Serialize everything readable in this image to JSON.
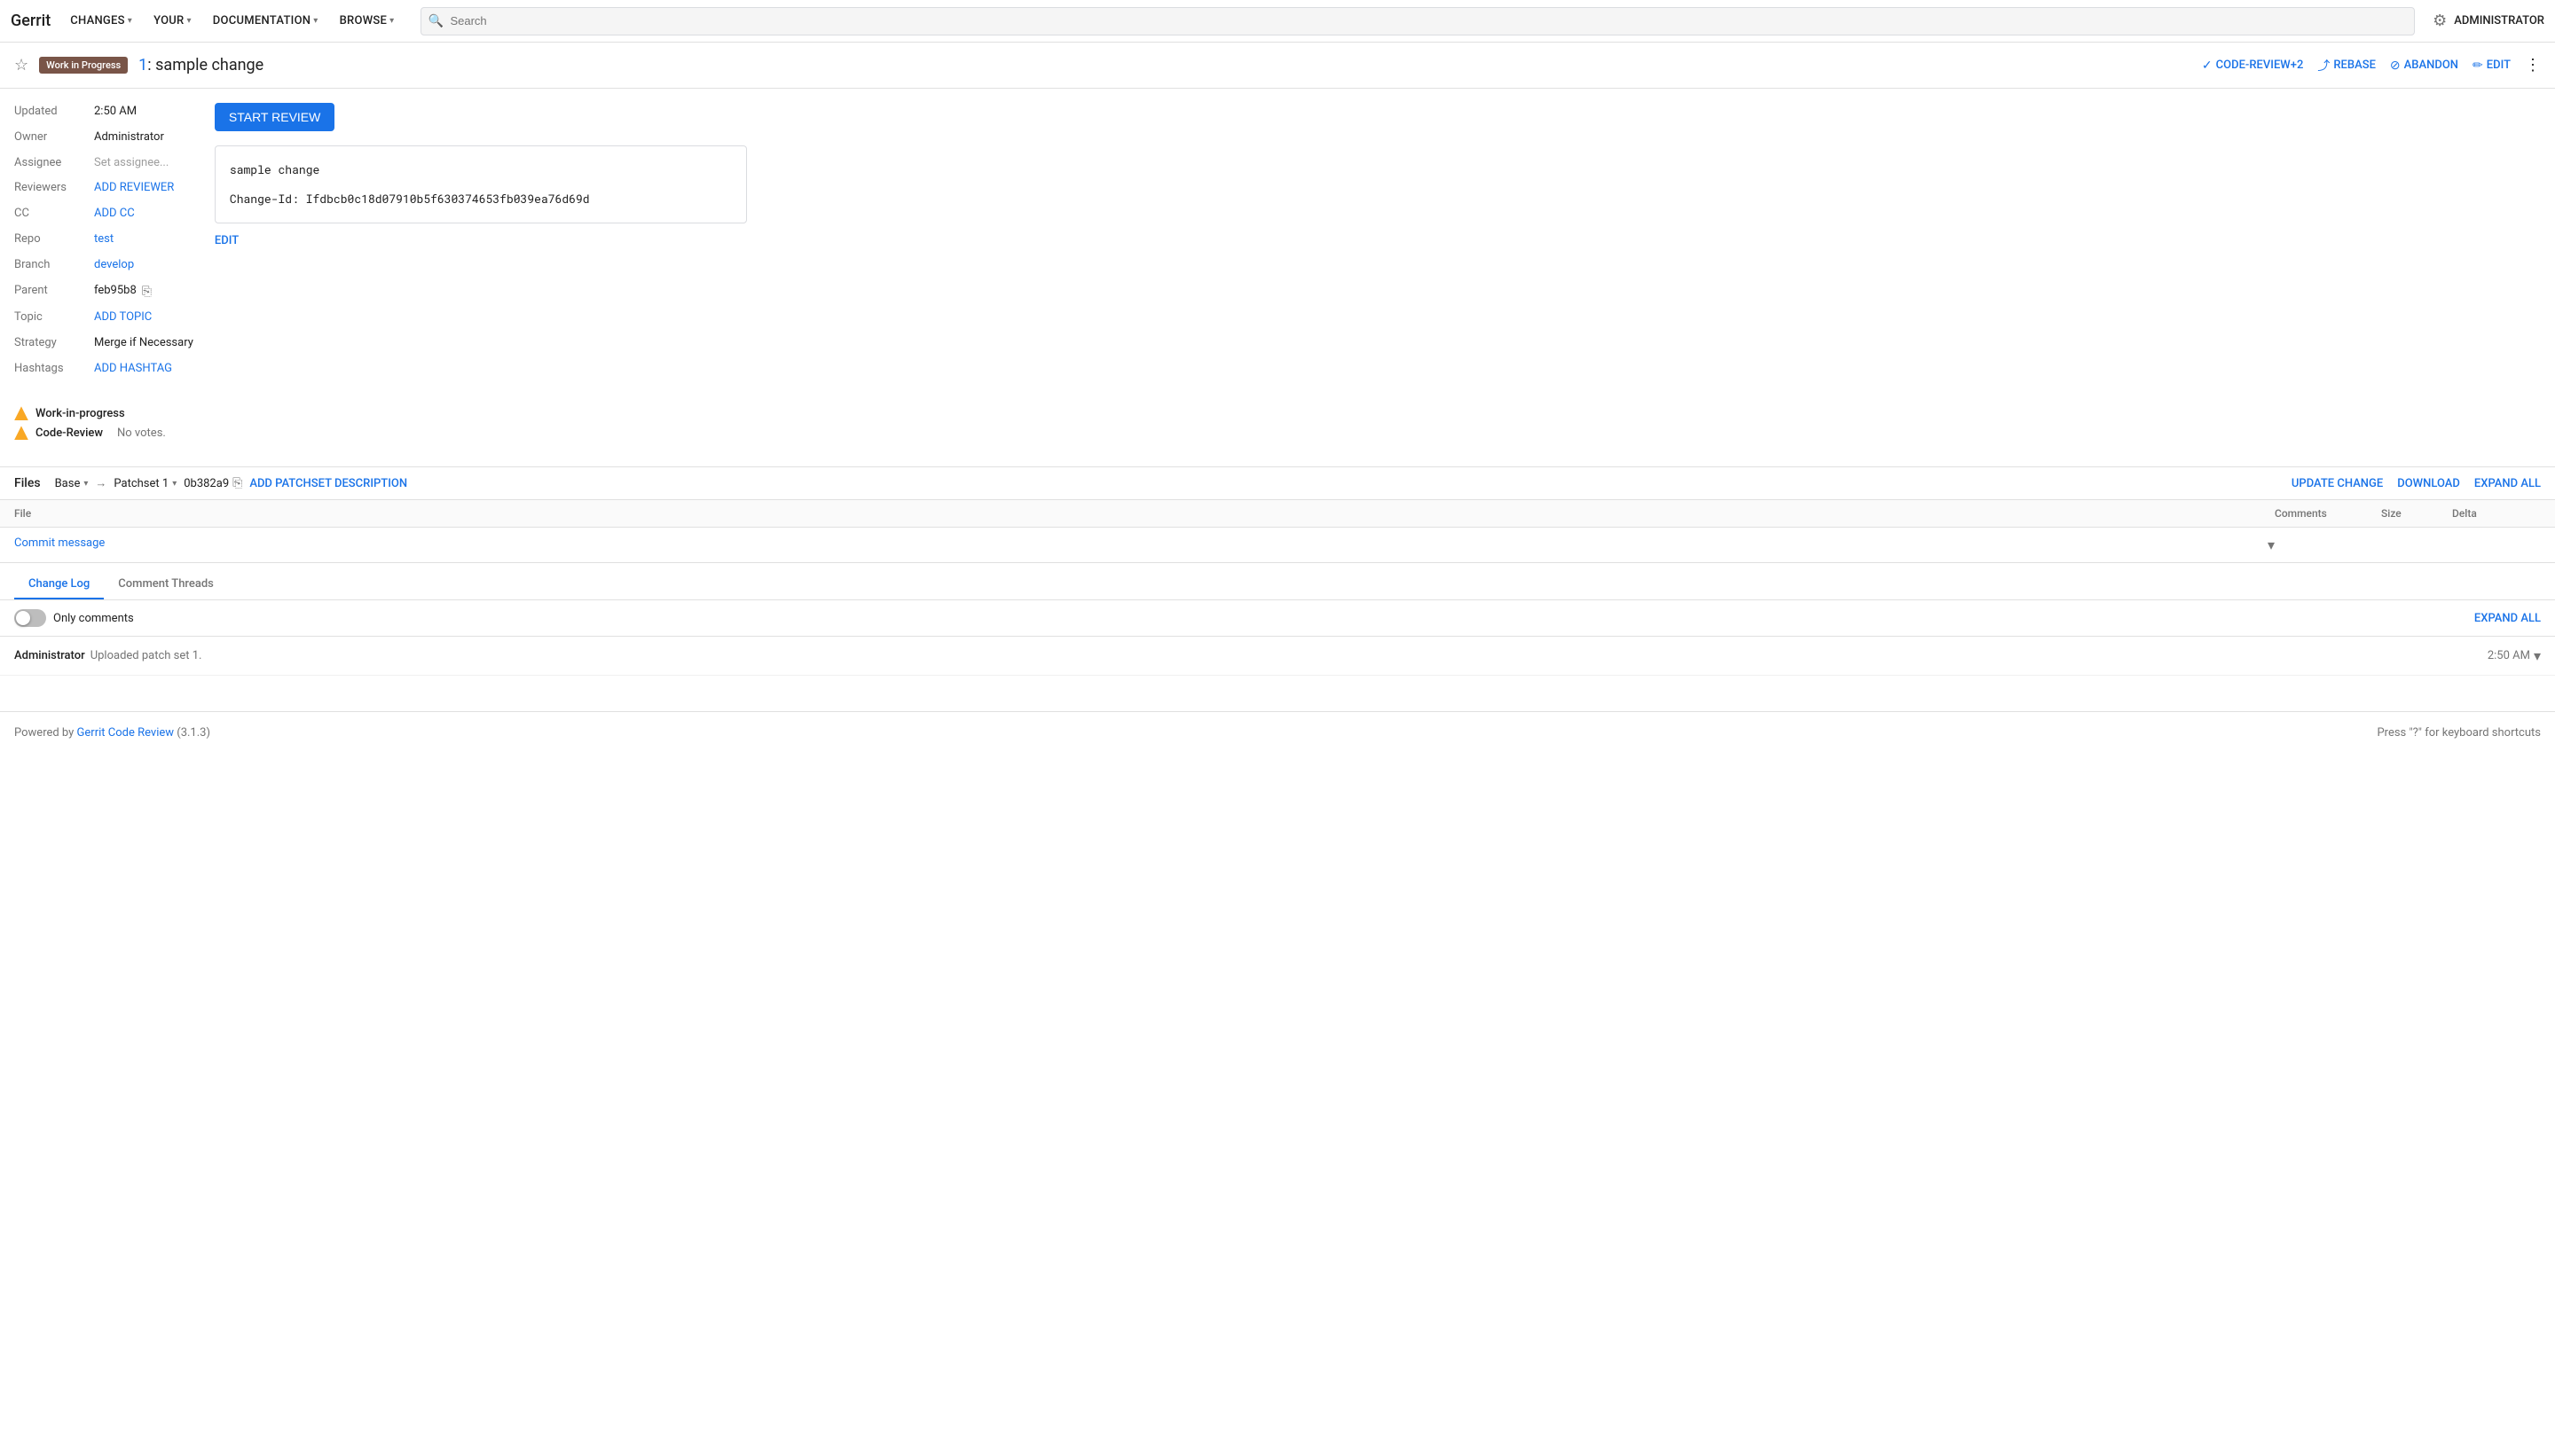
{
  "nav": {
    "logo": "Gerrit",
    "items": [
      {
        "label": "CHANGES",
        "id": "changes"
      },
      {
        "label": "YOUR",
        "id": "your"
      },
      {
        "label": "DOCUMENTATION",
        "id": "documentation"
      },
      {
        "label": "BROWSE",
        "id": "browse"
      }
    ],
    "search_placeholder": "Search",
    "user": "ADMINISTRATOR"
  },
  "change_header": {
    "wip_label": "Work in Progress",
    "change_number": "1",
    "change_title": "sample change",
    "actions": {
      "code_review": "CODE-REVIEW+2",
      "rebase": "REBASE",
      "abandon": "ABANDON",
      "edit": "EDIT"
    }
  },
  "meta": {
    "updated_label": "Updated",
    "updated_value": "2:50 AM",
    "owner_label": "Owner",
    "owner_value": "Administrator",
    "assignee_label": "Assignee",
    "assignee_placeholder": "Set assignee...",
    "reviewers_label": "Reviewers",
    "reviewers_action": "ADD REVIEWER",
    "cc_label": "CC",
    "cc_action": "ADD CC",
    "repo_label": "Repo",
    "repo_value": "test",
    "branch_label": "Branch",
    "branch_value": "develop",
    "parent_label": "Parent",
    "parent_value": "feb95b8",
    "topic_label": "Topic",
    "topic_action": "ADD TOPIC",
    "strategy_label": "Strategy",
    "strategy_value": "Merge if Necessary",
    "hashtags_label": "Hashtags",
    "hashtags_action": "ADD HASHTAG"
  },
  "labels": [
    {
      "name": "Work-in-progress",
      "votes": ""
    },
    {
      "name": "Code-Review",
      "votes": "No votes."
    }
  ],
  "description": {
    "start_review_btn": "START REVIEW",
    "commit_message_line1": "sample change",
    "commit_message_line2": "",
    "commit_message_line3": "Change-Id: Ifdbcb0c18d07910b5f630374653fb039ea76d69d",
    "edit_label": "EDIT"
  },
  "files": {
    "title": "Files",
    "base_label": "Base",
    "arrow": "→",
    "patchset_label": "Patchset 1",
    "patchset_hash": "0b382a9",
    "add_patchset_label": "ADD PATCHSET DESCRIPTION",
    "actions": {
      "update_change": "UPDATE CHANGE",
      "download": "DOWNLOAD",
      "expand_all": "EXPAND ALL"
    },
    "columns": {
      "file": "File",
      "comments": "Comments",
      "size": "Size",
      "delta": "Delta"
    },
    "rows": [
      {
        "name": "Commit message",
        "comments": "",
        "size": "",
        "delta": ""
      }
    ]
  },
  "tabs": {
    "items": [
      {
        "label": "Change Log",
        "active": true
      },
      {
        "label": "Comment Threads",
        "active": false
      }
    ]
  },
  "changelog": {
    "only_comments_label": "Only comments",
    "expand_all_label": "EXPAND ALL",
    "entries": [
      {
        "user": "Administrator",
        "text": "Uploaded patch set 1.",
        "time": "2:50 AM"
      }
    ]
  },
  "footer": {
    "powered_by": "Powered by ",
    "link_text": "Gerrit Code Review",
    "version": " (3.1.3)",
    "shortcut_hint": "Press \"?\" for keyboard shortcuts"
  }
}
